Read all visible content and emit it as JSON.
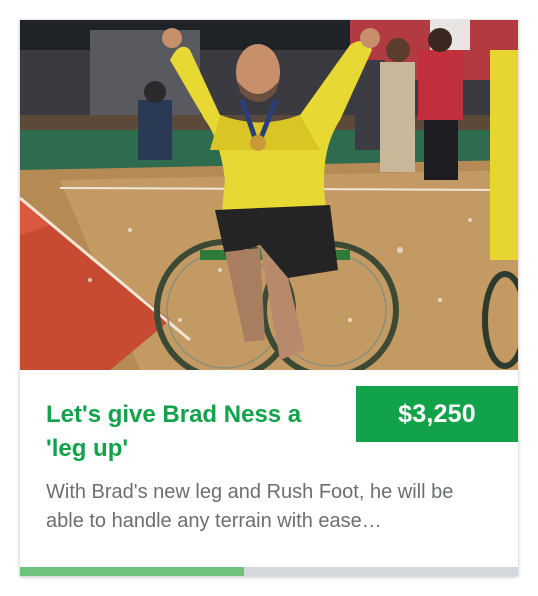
{
  "campaign": {
    "title": "Let's give Brad Ness a 'leg up'",
    "amount": "$3,250",
    "description": "With Brad's new leg and Rush Foot, he will be able to handle any terrain with ease…",
    "progress_fraction": 0.45
  },
  "colors": {
    "accent": "#12a24a",
    "progress": "#6fc27a",
    "track": "#d4d8da",
    "body_text": "#6a6f73"
  }
}
